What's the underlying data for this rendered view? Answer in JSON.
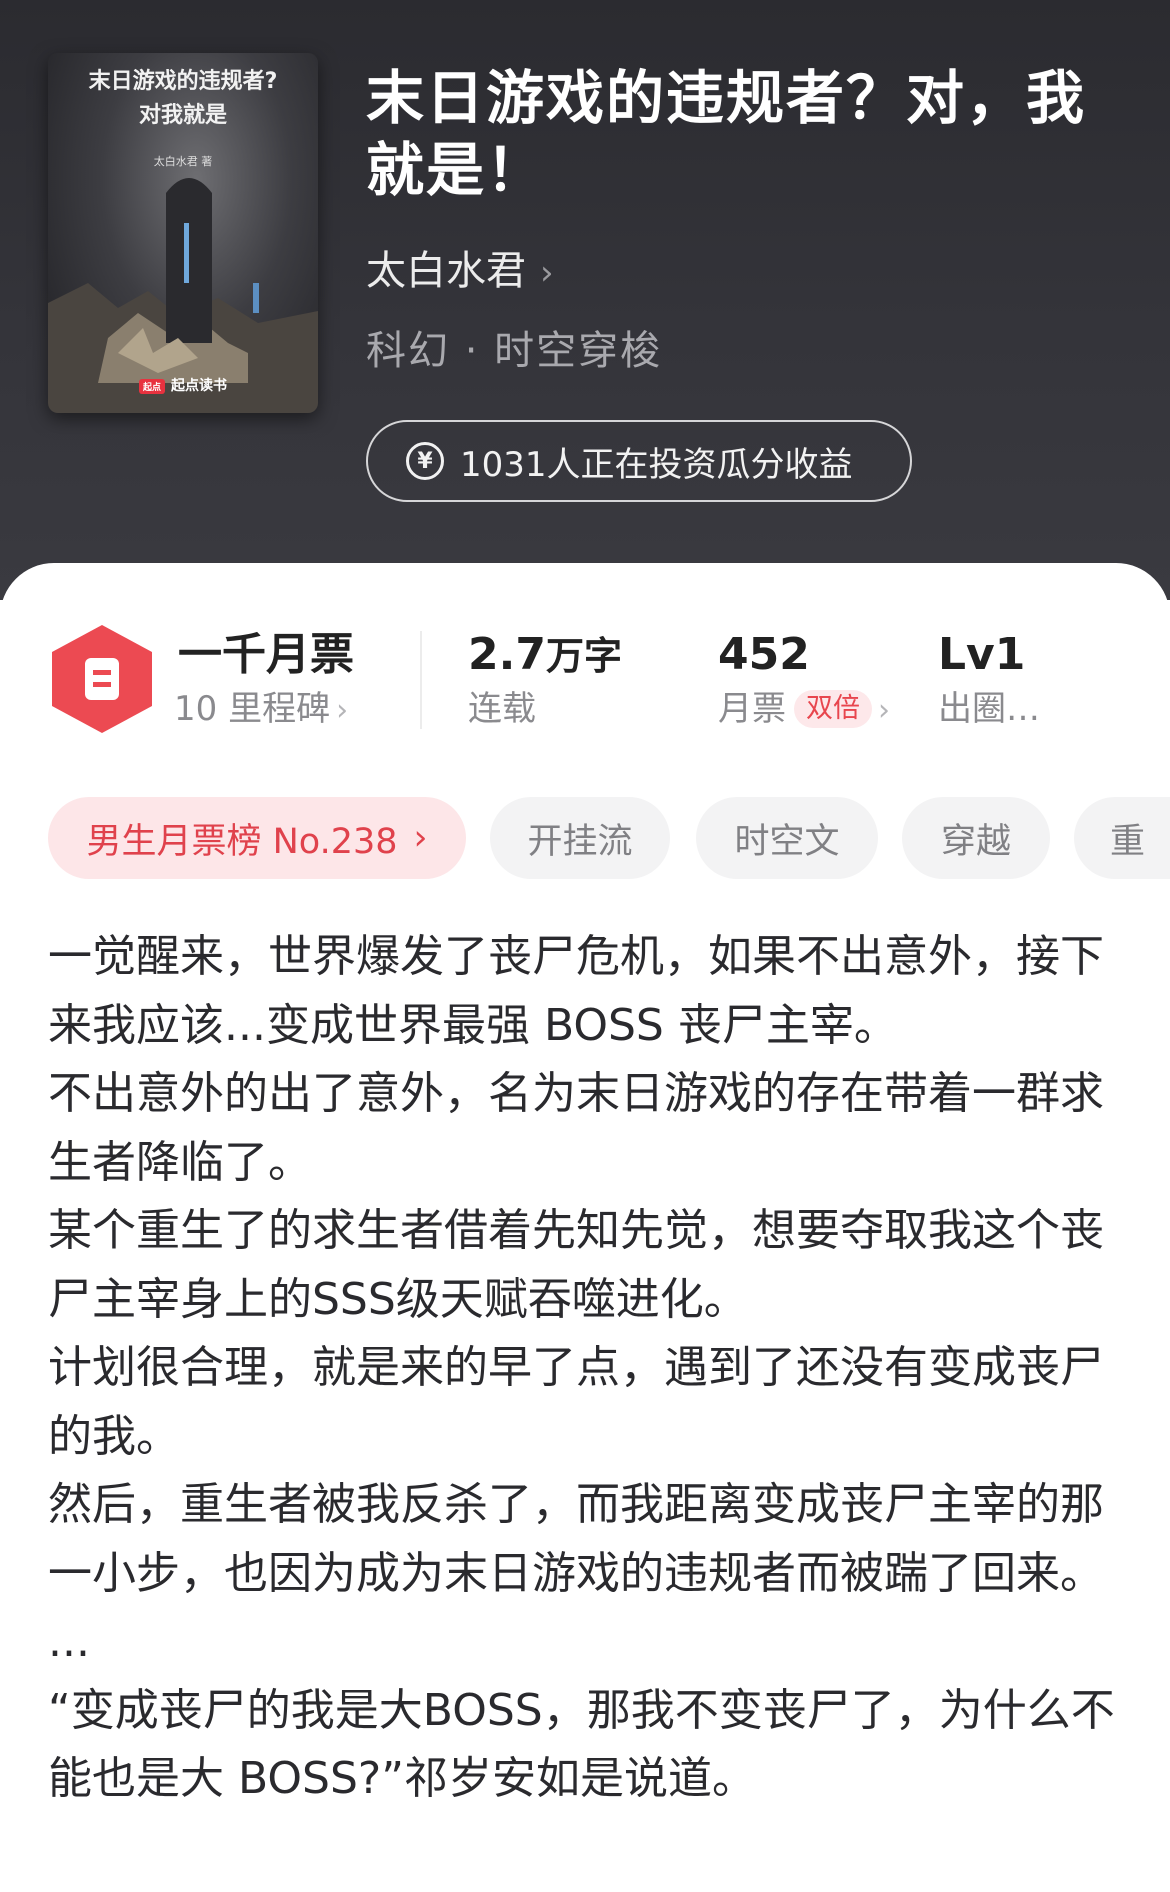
{
  "book": {
    "title": "末日游戏的违规者？对，我就是！",
    "author": "太白水君",
    "genre": "科幻 · 时空穿梭",
    "invest_text": "1031人正在投资瓜分收益",
    "cover": {
      "title_line1": "末日游戏的违规者?",
      "title_line2": "对我就是",
      "author": "太白水君 著",
      "publisher_mark": "起点",
      "publisher": "起点读书"
    }
  },
  "stats": {
    "milestone_title": "一千月票",
    "milestone_sub": "10 里程碑",
    "words_value": "2.7",
    "words_unit": "万字",
    "words_status": "连载",
    "tickets_value": "452",
    "tickets_label": "月票",
    "tickets_badge": "双倍",
    "level_value": "Lv1",
    "level_label": "出圈…"
  },
  "tags": [
    "男生月票榜 No.238",
    "开挂流",
    "时空文",
    "穿越",
    "重"
  ],
  "description": [
    "一觉醒来，世界爆发了丧尸危机，如果不出意外，接下来我应该...变成世界最强 BOSS 丧尸主宰。",
    "不出意外的出了意外，名为末日游戏的存在带着一群求生者降临了。",
    "某个重生了的求生者借着先知先觉，想要夺取我这个丧尸主宰身上的SSS级天赋吞噬进化。",
    "计划很合理，就是来的早了点，遇到了还没有变成丧尸的我。",
    "然后，重生者被我反杀了，而我距离变成丧尸主宰的那一小步，也因为成为末日游戏的违规者而被踹了回来。",
    "...",
    "“变成丧尸的我是大BOSS，那我不变丧尸了，为什么不能也是大 BOSS?”祁岁安如是说道。"
  ],
  "colors": {
    "header_bg": "#2e2e33",
    "accent_red": "#ec4a52",
    "tag_bg": "#f3f3f4"
  }
}
